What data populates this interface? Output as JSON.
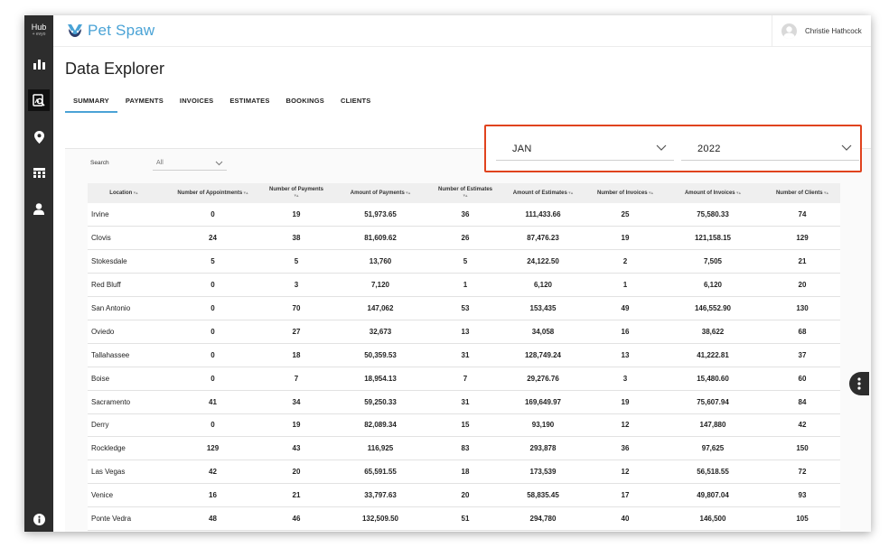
{
  "sidebar": {
    "logo_top": "Hub",
    "logo_sub": "+ evyo",
    "icons": [
      "bar-chart-icon",
      "data-explorer-icon",
      "location-pin-icon",
      "calendar-icon",
      "user-icon",
      "info-icon"
    ]
  },
  "header": {
    "brand": "Pet Spaw",
    "user_name": "Christie Hathcock"
  },
  "page": {
    "title": "Data Explorer"
  },
  "tabs": [
    {
      "label": "SUMMARY",
      "active": true
    },
    {
      "label": "PAYMENTS",
      "active": false
    },
    {
      "label": "INVOICES",
      "active": false
    },
    {
      "label": "ESTIMATES",
      "active": false
    },
    {
      "label": "BOOKINGS",
      "active": false
    },
    {
      "label": "CLIENTS",
      "active": false
    }
  ],
  "filters": {
    "month": "JAN",
    "year": "2022",
    "search_label": "Search",
    "search_value": "All",
    "highlight_color": "#e0431e"
  },
  "table": {
    "headers": [
      "Location",
      "Number of Appointments",
      "Number of Payments",
      "Amount of Payments",
      "Number of Estimates",
      "Amount of Estimates",
      "Number of Invoices",
      "Amount of Invoices",
      "Number of Clients"
    ],
    "rows": [
      [
        "Irvine",
        "0",
        "19",
        "51,973.65",
        "36",
        "111,433.66",
        "25",
        "75,580.33",
        "74"
      ],
      [
        "Clovis",
        "24",
        "38",
        "81,609.62",
        "26",
        "87,476.23",
        "19",
        "121,158.15",
        "129"
      ],
      [
        "Stokesdale",
        "5",
        "5",
        "13,760",
        "5",
        "24,122.50",
        "2",
        "7,505",
        "21"
      ],
      [
        "Red Bluff",
        "0",
        "3",
        "7,120",
        "1",
        "6,120",
        "1",
        "6,120",
        "20"
      ],
      [
        "San Antonio",
        "0",
        "70",
        "147,062",
        "53",
        "153,435",
        "49",
        "146,552.90",
        "130"
      ],
      [
        "Oviedo",
        "0",
        "27",
        "32,673",
        "13",
        "34,058",
        "16",
        "38,622",
        "68"
      ],
      [
        "Tallahassee",
        "0",
        "18",
        "50,359.53",
        "31",
        "128,749.24",
        "13",
        "41,222.81",
        "37"
      ],
      [
        "Boise",
        "0",
        "7",
        "18,954.13",
        "7",
        "29,276.76",
        "3",
        "15,480.60",
        "60"
      ],
      [
        "Sacramento",
        "41",
        "34",
        "59,250.33",
        "31",
        "169,649.97",
        "19",
        "75,607.94",
        "84"
      ],
      [
        "Derry",
        "0",
        "19",
        "82,089.34",
        "15",
        "93,190",
        "12",
        "147,880",
        "42"
      ],
      [
        "Rockledge",
        "129",
        "43",
        "116,925",
        "83",
        "293,878",
        "36",
        "97,625",
        "150"
      ],
      [
        "Las Vegas",
        "42",
        "20",
        "65,591.55",
        "18",
        "173,539",
        "12",
        "56,518.55",
        "72"
      ],
      [
        "Venice",
        "16",
        "21",
        "33,797.63",
        "20",
        "58,835.45",
        "17",
        "49,807.04",
        "93"
      ],
      [
        "Ponte Vedra",
        "48",
        "46",
        "132,509.50",
        "51",
        "294,780",
        "40",
        "146,500",
        "105"
      ]
    ]
  },
  "colors": {
    "sidebar": "#2d2d2d",
    "accent": "#4aa3d6"
  }
}
